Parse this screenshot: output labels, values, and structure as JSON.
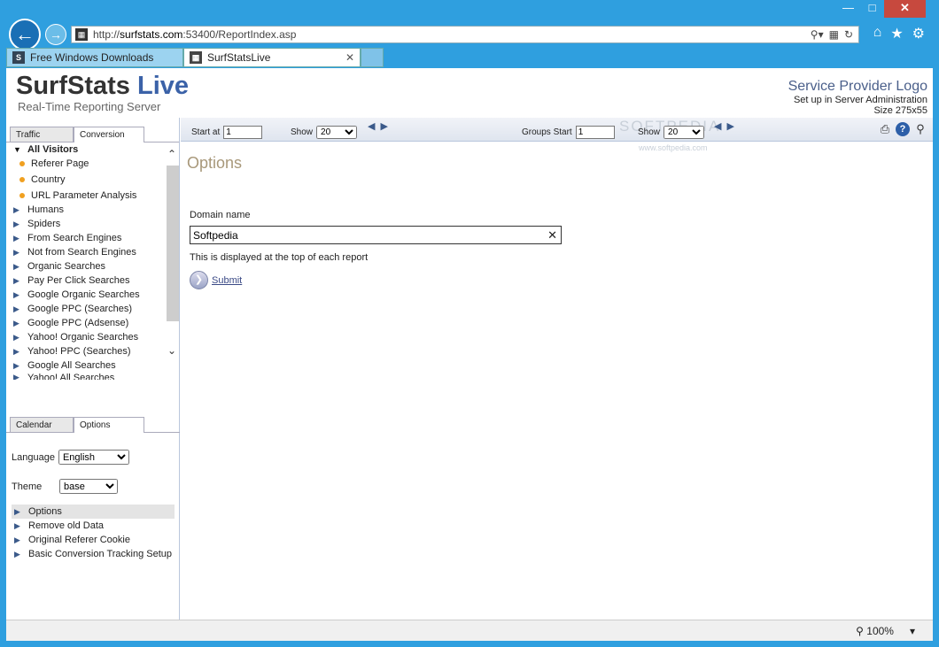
{
  "browser": {
    "url_prefix": "http://",
    "url_host": "surfstats.com",
    "url_rest": ":53400/ReportIndex.asp",
    "tabs": [
      {
        "label": "Free Windows Downloads",
        "favicon": "S",
        "active": false
      },
      {
        "label": "SurfStatsLive",
        "favicon": "S",
        "active": true
      }
    ],
    "zoom": "100%"
  },
  "header": {
    "logo_main": "SurfStats",
    "logo_accent": "Live",
    "logo_sub": "Real-Time Reporting Server",
    "sp_title": "Service Provider Logo",
    "sp_line1": "Set up in Server Administration",
    "sp_line2": "Size 275x55"
  },
  "left_top_tabs": [
    "Traffic",
    "Conversion"
  ],
  "tree": {
    "root": "All Visitors",
    "children": [
      "Referer Page",
      "Country",
      "URL Parameter Analysis"
    ],
    "items": [
      "Humans",
      "Spiders",
      "From Search Engines",
      "Not from Search Engines",
      "Organic Searches",
      "Pay Per Click Searches",
      "Google Organic Searches",
      "Google PPC (Searches)",
      "Google PPC (Adsense)",
      "Yahoo! Organic Searches",
      "Yahoo! PPC (Searches)",
      "Google All Searches",
      "Yahoo! All Searches"
    ]
  },
  "left_bottom_tabs": [
    "Calendar",
    "Options"
  ],
  "settings": {
    "language_label": "Language",
    "language_value": "English",
    "theme_label": "Theme",
    "theme_value": "base"
  },
  "options_list": [
    "Options",
    "Remove old Data",
    "Original Referer Cookie",
    "Basic Conversion Tracking Setup"
  ],
  "toolbar": {
    "start_at_label": "Start at",
    "start_at_value": "1",
    "show_label": "Show",
    "show_value": "20",
    "groups_start_label": "Groups Start",
    "groups_start_value": "1",
    "show2_label": "Show",
    "show2_value": "20"
  },
  "watermark": {
    "main": "SOFTPEDIA",
    "sub": "www.softpedia.com"
  },
  "main": {
    "title": "Options",
    "domain_label": "Domain name",
    "domain_value": "Softpedia",
    "domain_hint": "This is displayed at the top of each report",
    "submit_label": "Submit"
  },
  "colors": {
    "frame": "#2f9fdf",
    "accent_blue": "#3b62a8",
    "title_tan": "#a8987a",
    "orange_dot": "#f0a020"
  },
  "icons": {
    "back": "arrow-left",
    "forward": "arrow-right",
    "home": "home",
    "favorites": "star",
    "settings": "gear",
    "print": "printer",
    "help": "question",
    "find": "magnifier"
  }
}
